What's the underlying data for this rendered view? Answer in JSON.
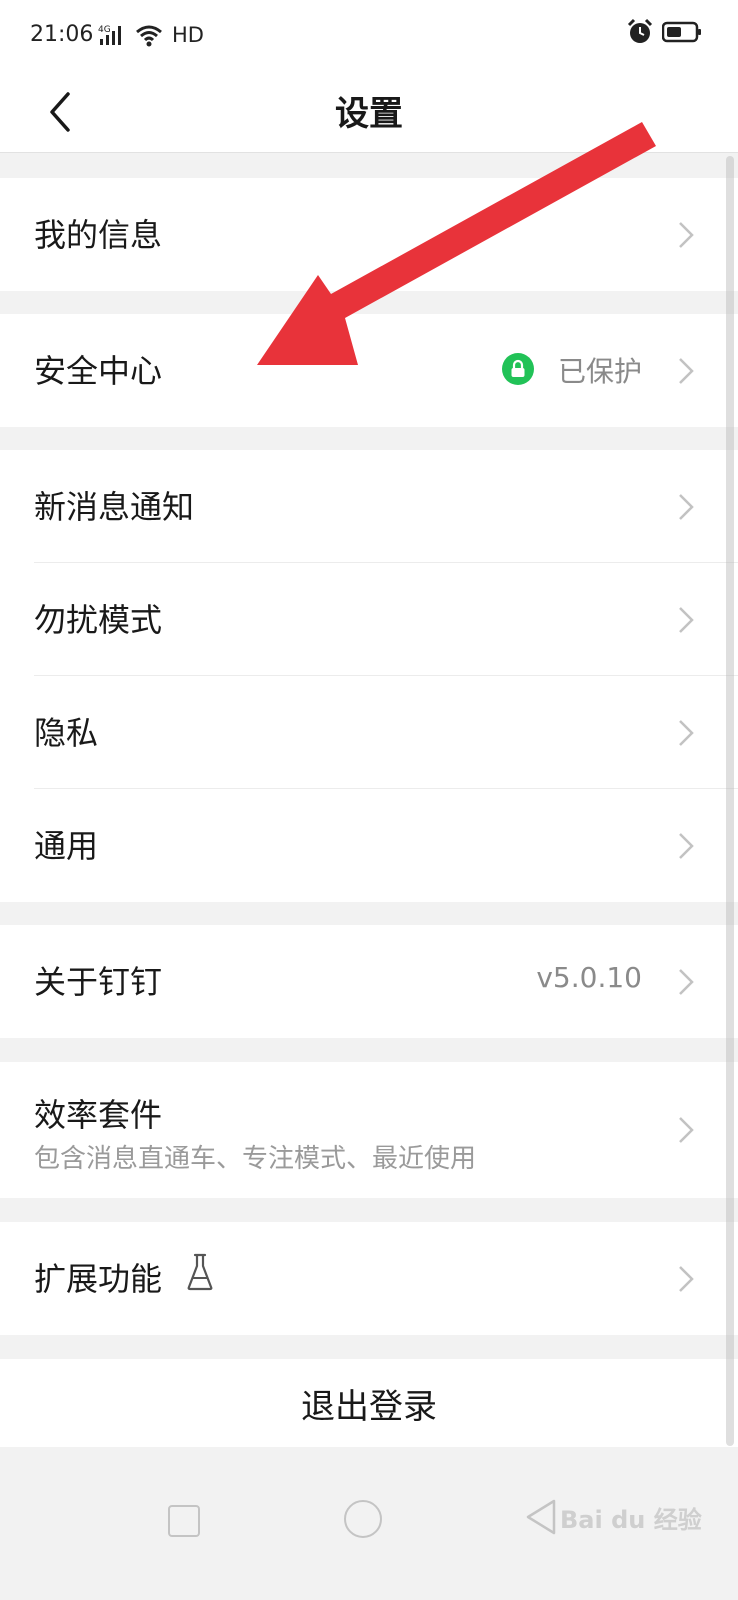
{
  "status_bar": {
    "time": "21:06",
    "network_label": "4G",
    "hd_label": "HD",
    "icons": [
      "signal-icon",
      "wifi-icon",
      "alarm-icon",
      "battery-icon"
    ]
  },
  "header": {
    "title": "设置",
    "back_icon": "chevron-left-icon"
  },
  "settings": {
    "my_info": {
      "label": "我的信息"
    },
    "security": {
      "label": "安全中心",
      "status": "已保护",
      "status_color": "#21c257"
    },
    "notifications": {
      "label": "新消息通知"
    },
    "do_not_disturb": {
      "label": "勿扰模式"
    },
    "privacy": {
      "label": "隐私"
    },
    "general": {
      "label": "通用"
    },
    "about": {
      "label": "关于钉钉",
      "version": "v5.0.10"
    },
    "efficiency": {
      "label": "效率套件",
      "subtitle": "包含消息直通车、专注模式、最近使用"
    },
    "extensions": {
      "label": "扩展功能"
    },
    "logout": {
      "label": "退出登录"
    }
  },
  "annotation": {
    "arrow_color": "#e8333a"
  },
  "watermark": {
    "text": "Bai du 经验"
  }
}
